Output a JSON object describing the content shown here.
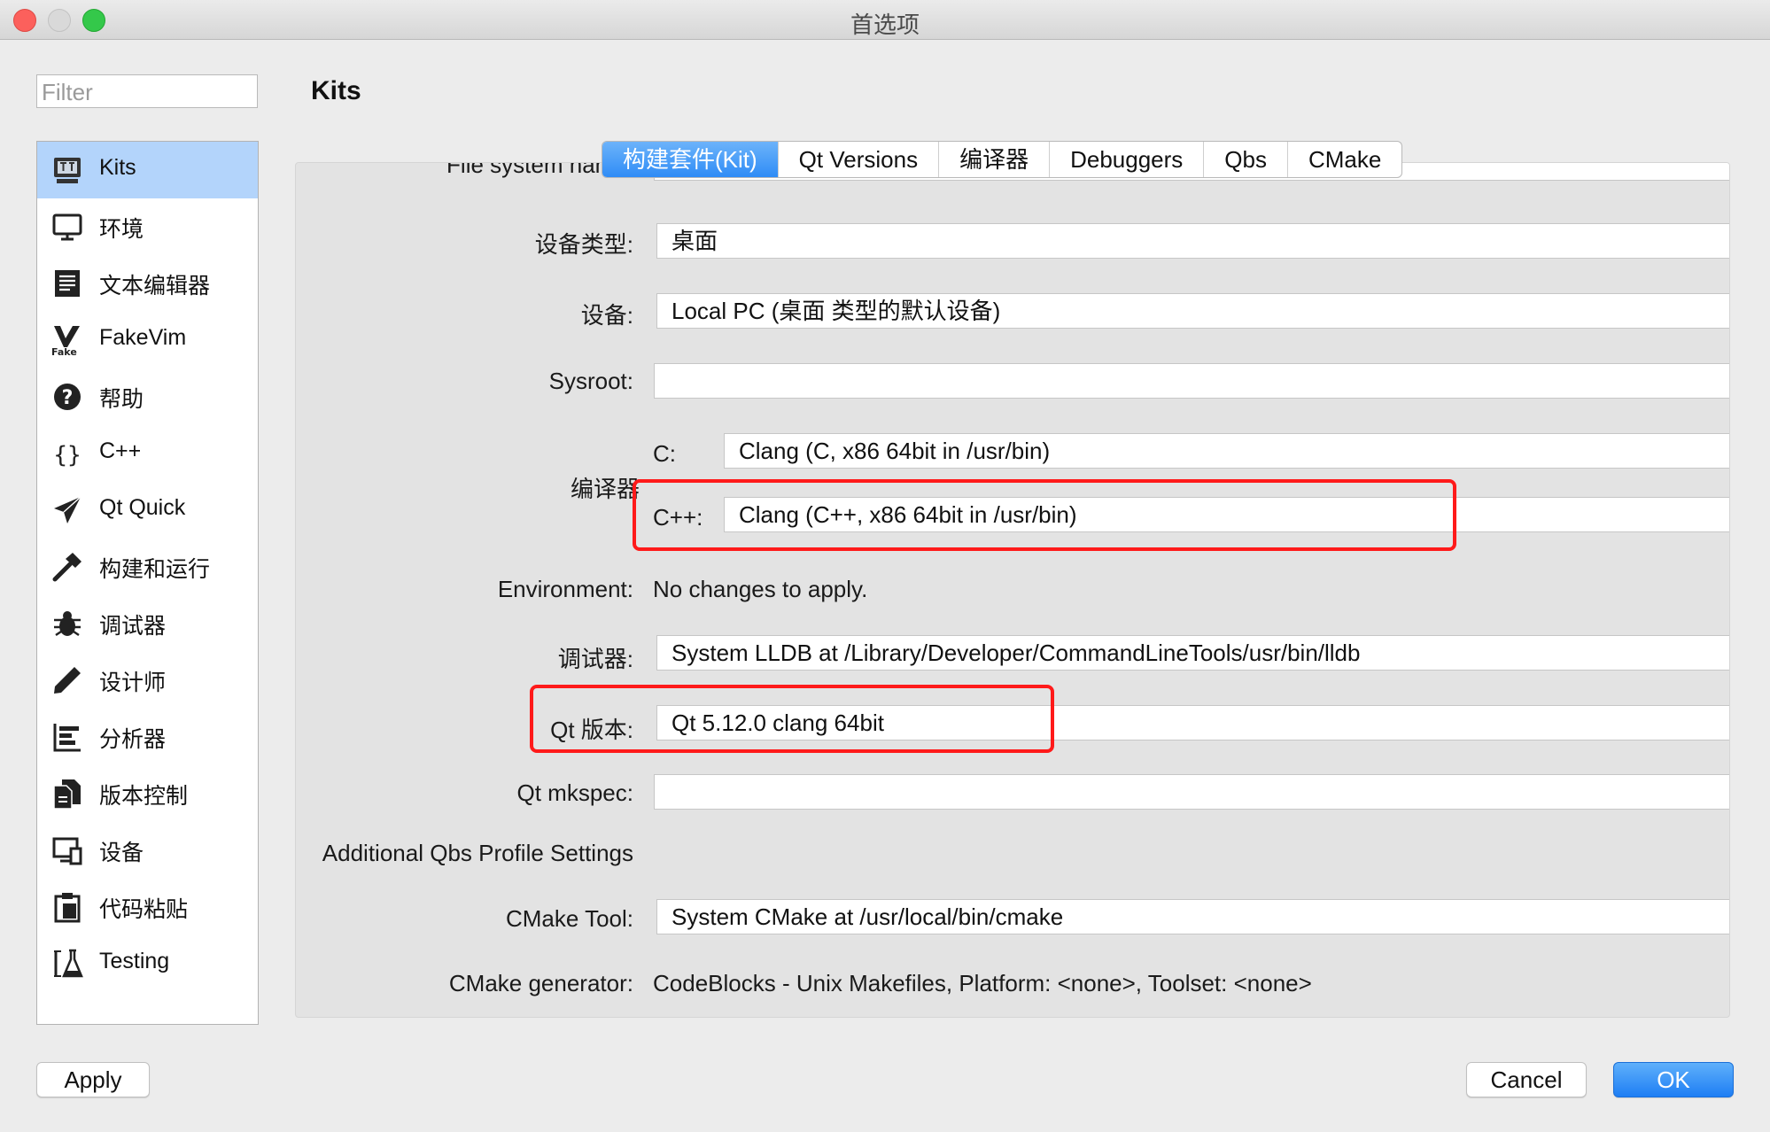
{
  "window": {
    "title": "首选项"
  },
  "filter": {
    "placeholder": "Filter"
  },
  "sidebar": {
    "items": [
      {
        "label": "Kits",
        "icon": "kits-icon",
        "active": true
      },
      {
        "label": "环境",
        "icon": "monitor-icon"
      },
      {
        "label": "文本编辑器",
        "icon": "text-editor-icon"
      },
      {
        "label": "FakeVim",
        "icon": "fakevim-icon"
      },
      {
        "label": "帮助",
        "icon": "help-icon"
      },
      {
        "label": "C++",
        "icon": "braces-icon"
      },
      {
        "label": "Qt Quick",
        "icon": "paper-plane-icon"
      },
      {
        "label": "构建和运行",
        "icon": "hammer-icon"
      },
      {
        "label": "调试器",
        "icon": "bug-icon"
      },
      {
        "label": "设计师",
        "icon": "pencil-icon"
      },
      {
        "label": "分析器",
        "icon": "analyzer-icon"
      },
      {
        "label": "版本控制",
        "icon": "version-control-icon"
      },
      {
        "label": "设备",
        "icon": "device-icon"
      },
      {
        "label": "代码粘贴",
        "icon": "clipboard-icon"
      },
      {
        "label": "Testing",
        "icon": "flask-icon"
      }
    ]
  },
  "page": {
    "heading": "Kits"
  },
  "tabs": [
    {
      "label": "构建套件(Kit)",
      "active": true
    },
    {
      "label": "Qt Versions"
    },
    {
      "label": "编译器"
    },
    {
      "label": "Debuggers"
    },
    {
      "label": "Qbs"
    },
    {
      "label": "CMake"
    }
  ],
  "form": {
    "file_system_name_label": "File system name:",
    "device_type_label": "设备类型:",
    "device_type_value": "桌面",
    "device_label": "设备:",
    "device_value": "Local PC (桌面 类型的默认设备)",
    "sysroot_label": "Sysroot:",
    "compiler_label": "编译器",
    "c_label": "C:",
    "c_value": "Clang (C, x86 64bit in /usr/bin)",
    "cpp_label": "C++:",
    "cpp_value": "Clang (C++, x86 64bit in /usr/bin)",
    "environment_label": "Environment:",
    "environment_value": "No changes to apply.",
    "debugger_label": "调试器:",
    "debugger_value": "System LLDB at /Library/Developer/CommandLineTools/usr/bin/lldb",
    "qt_version_label": "Qt 版本:",
    "qt_version_value": "Qt 5.12.0 clang 64bit",
    "qt_mkspec_label": "Qt mkspec:",
    "qbs_section_label": "Additional Qbs Profile Settings",
    "cmake_tool_label": "CMake Tool:",
    "cmake_tool_value": "System CMake at /usr/local/bin/cmake",
    "cmake_generator_label": "CMake generator:",
    "cmake_generator_value": "CodeBlocks - Unix Makefiles, Platform: <none>, Toolset: <none>"
  },
  "buttons": {
    "apply": "Apply",
    "cancel": "Cancel",
    "ok": "OK"
  },
  "colors": {
    "accent": "#2f8cf6",
    "highlight": "#ff1a1a",
    "selection": "#b3d4fb"
  }
}
